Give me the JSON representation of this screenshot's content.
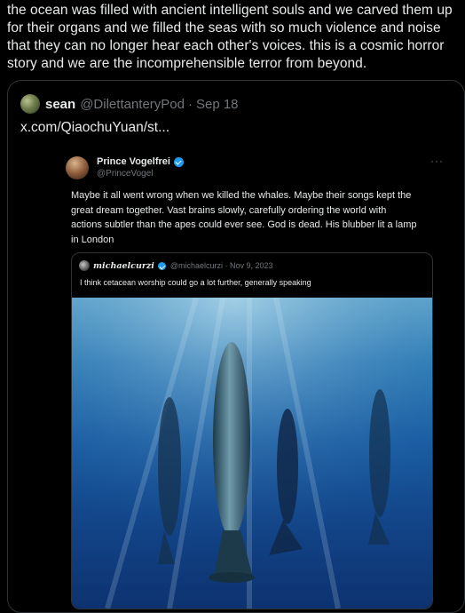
{
  "post": {
    "text": "the ocean was filled with ancient intelligent souls and we carved them up for their organs and we filled the seas with so much violence and noise that they can no longer hear each other's voices. this is a cosmic horror story and we are the incomprehensible terror from beyond."
  },
  "quoted": {
    "name": "sean",
    "handle": "@DilettanteryPod",
    "dot": "·",
    "date": "Sep 18",
    "link": "x.com/QiaochuYuan/st..."
  },
  "embed": {
    "name": "Prince Vogelfrei",
    "handle": "@PrinceVogel",
    "more": "···",
    "text": "Maybe it all went wrong when we killed the whales. Maybe their songs kept the great dream together. Vast brains slowly, carefully ordering the world with actions subtler than the apes could ever see. God is dead. His blubber lit a lamp in London",
    "inner": {
      "name": "michaelcurzi",
      "handle": "@michaelcurzi · Nov 9, 2023",
      "text": "I think cetacean worship could go a lot further, generally speaking"
    }
  },
  "colors": {
    "background": "#000000",
    "text": "#e7e9ea",
    "muted": "#71767b",
    "border": "#2f3336",
    "verified": "#1d9bf0"
  },
  "icons": {
    "verified": "verified-badge-icon",
    "more": "more-options-icon"
  }
}
